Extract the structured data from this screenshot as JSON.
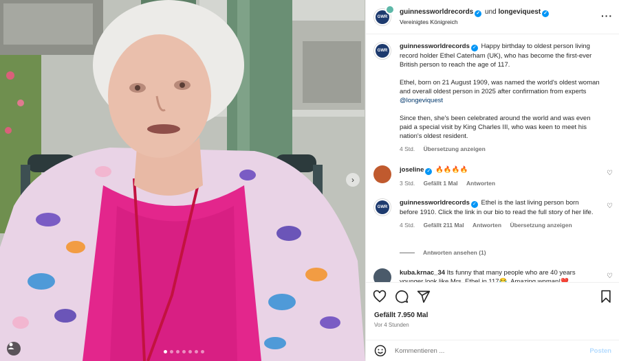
{
  "header": {
    "username": "guinnessworldrecords",
    "joiner": "und",
    "collaborator": "longeviquest",
    "location": "Vereinigtes Königreich"
  },
  "caption": {
    "username": "guinnessworldrecords",
    "para1": "Happy birthday to oldest person living record holder Ethel Caterham (UK), who has become the first-ever British person to reach the age of 117.",
    "para2_text": "Ethel, born on 21 August 1909, was named the world's oldest woman and overall oldest person in 2025 after confirmation from experts ",
    "para2_mention": "@longeviquest",
    "para3": "Since then, she's been celebrated around the world and was even paid a special visit by King Charles III, who was keen to meet his nation's oldest resident.",
    "time": "4 Std.",
    "translate": "Übersetzung anzeigen"
  },
  "comments": [
    {
      "username": "joseline",
      "text": "🔥🔥🔥🔥",
      "time": "3 Std.",
      "likes": "Gefällt 1 Mal",
      "reply": "Antworten"
    },
    {
      "username": "guinnessworldrecords",
      "text": "Ethel is the last living person born before 1910. Click the link in our bio to read the full story of her life.",
      "time": "4 Std.",
      "likes": "Gefällt 211 Mal",
      "reply": "Antworten",
      "translate": "Übersetzung anzeigen",
      "view_replies": "Antworten ansehen (1)"
    },
    {
      "username": "kuba.krnac_34",
      "text": "Its funny that many people who are 40 years younger look like Mrs. Ethel in 117😂. Amazing woman!❤️"
    }
  ],
  "footer": {
    "likes": "Gefällt 7.950 Mal",
    "ago": "Vor 4 Stunden",
    "comment_placeholder": "Kommentieren ...",
    "post_label": "Posten"
  },
  "colors": {
    "link": "#00376b",
    "verified": "#0095f6",
    "post_disabled": "#b3dbff"
  },
  "carousel": {
    "count": 7,
    "active_index": 0
  }
}
